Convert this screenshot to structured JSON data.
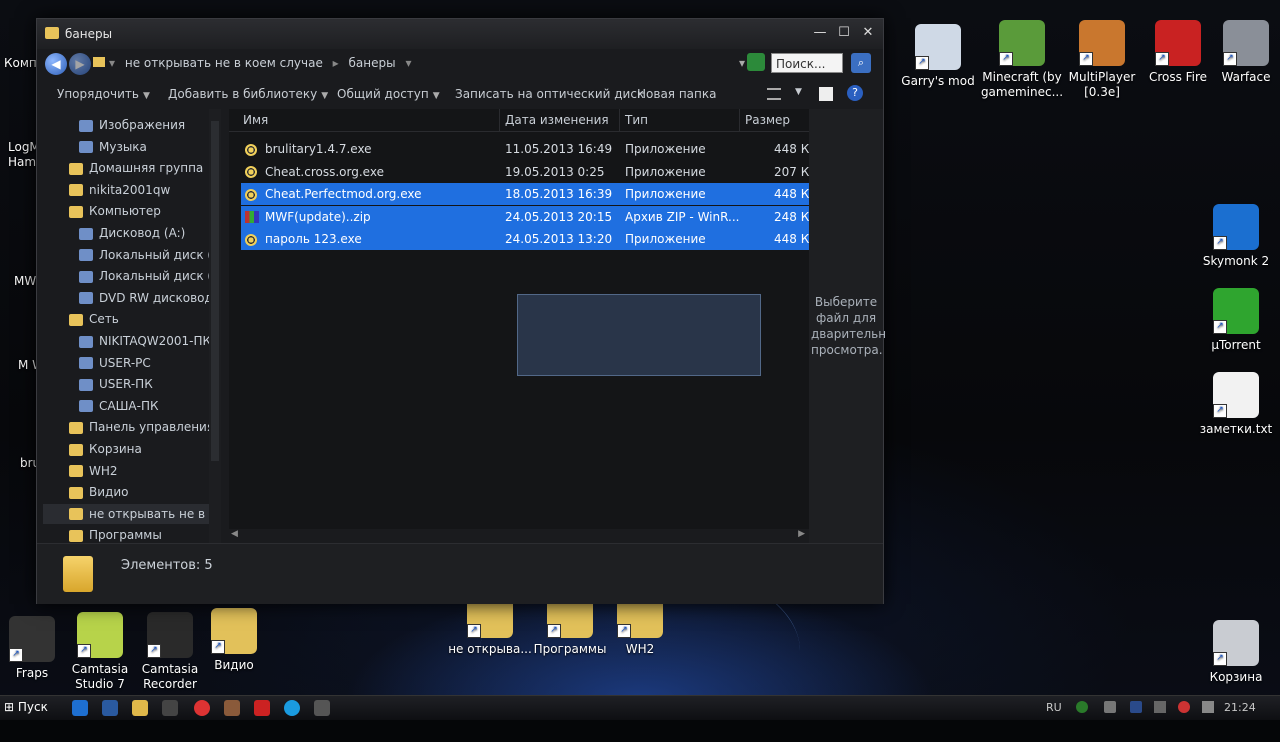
{
  "window": {
    "title": "банеры",
    "breadcrumbs": [
      "не открывать не в коем случае",
      "банеры"
    ],
    "search_placeholder": "Поиск...",
    "toolbar": [
      "Упорядочить",
      "Добавить в библиотеку",
      "Общий доступ",
      "Записать на оптический диск",
      "Новая папка"
    ],
    "columns": [
      "Имя",
      "Дата изменения",
      "Тип",
      "Размер"
    ],
    "files": [
      {
        "name": "brulitary1.4.7.exe",
        "date": "11.05.2013 16:49",
        "type": "Приложение",
        "size": "448 КБ",
        "selected": false,
        "icon": "app-icon"
      },
      {
        "name": "Cheat.cross.org.exe",
        "date": "19.05.2013 0:25",
        "type": "Приложение",
        "size": "207 КБ",
        "selected": false,
        "icon": "app-icon"
      },
      {
        "name": "Cheat.Perfectmod.org.exe",
        "date": "18.05.2013 16:39",
        "type": "Приложение",
        "size": "448 КБ",
        "selected": true,
        "icon": "app-icon"
      },
      {
        "name": "MWF(update)..zip",
        "date": "24.05.2013 20:15",
        "type": "Архив ZIP - WinR...",
        "size": "248 КБ",
        "selected": true,
        "icon": "zip-icon"
      },
      {
        "name": "пароль 123.exe",
        "date": "24.05.2013 13:20",
        "type": "Приложение",
        "size": "448 КБ",
        "selected": true,
        "icon": "app-icon"
      }
    ],
    "preview_text": "Выберите файл для дварительн просмотра.",
    "status": "Элементов: 5",
    "nav": [
      {
        "label": "Изображения",
        "indent": 2
      },
      {
        "label": "Музыка",
        "indent": 2
      },
      {
        "label": "Домашняя группа",
        "indent": 1
      },
      {
        "label": "nikita2001qw",
        "indent": 1
      },
      {
        "label": "Компьютер",
        "indent": 1
      },
      {
        "label": "Дисковод (A:)",
        "indent": 2
      },
      {
        "label": "Локальный диск (C:",
        "indent": 2
      },
      {
        "label": "Локальный диск (D:",
        "indent": 2
      },
      {
        "label": "DVD RW дисковод (",
        "indent": 2
      },
      {
        "label": "Сеть",
        "indent": 1
      },
      {
        "label": "NIKITAQW2001-ПК",
        "indent": 2
      },
      {
        "label": "USER-PC",
        "indent": 2
      },
      {
        "label": "USER-ПК",
        "indent": 2
      },
      {
        "label": "САША-ПК",
        "indent": 2
      },
      {
        "label": "Панель управления",
        "indent": 1
      },
      {
        "label": "Корзина",
        "indent": 1
      },
      {
        "label": "WH2",
        "indent": 1
      },
      {
        "label": "Видио",
        "indent": 1
      },
      {
        "label": "не открывать не в ко",
        "indent": 1,
        "selected": true
      },
      {
        "label": "Программы",
        "indent": 1
      }
    ]
  },
  "desktop_icons_right": [
    {
      "label": "Garry's mod",
      "color": "#cfd9e6"
    },
    {
      "label": "Minecraft (by gameminec...",
      "color": "#5a9b3a"
    },
    {
      "label": "MultiPlayer [0.3e]",
      "color": "#c9772e"
    },
    {
      "label": "Cross Fire",
      "color": "#c92222"
    },
    {
      "label": "Warface",
      "color": "#8a8f98"
    }
  ],
  "desktop_icons_side": [
    {
      "label": "Skymonk 2",
      "color": "#1b6fd0"
    },
    {
      "label": "μTorrent",
      "color": "#2fa52f"
    },
    {
      "label": "заметки.txt",
      "color": "#f2f2f2"
    }
  ],
  "desktop_icons_bottom": [
    {
      "label": "Fraps",
      "color": "#333"
    },
    {
      "label": "Camtasia Studio 7",
      "color": "#b7d34a"
    },
    {
      "label": "Camtasia Recorder",
      "color": "#2a2a2a"
    },
    {
      "label": "Видио",
      "color": "#e2c15a"
    },
    {
      "label": "не открыва...",
      "color": "#e2c15a"
    },
    {
      "label": "Программы",
      "color": "#e2c15a"
    },
    {
      "label": "WH2",
      "color": "#e2c15a"
    },
    {
      "label": "Корзина",
      "color": "#c9ccd2"
    }
  ],
  "desktop_left_fragments": [
    "Компь",
    "LogM Ham",
    "MW",
    "M Wa",
    "bru"
  ],
  "taskbar": {
    "start": "Пуск",
    "lang": "RU",
    "time": "21:24"
  }
}
